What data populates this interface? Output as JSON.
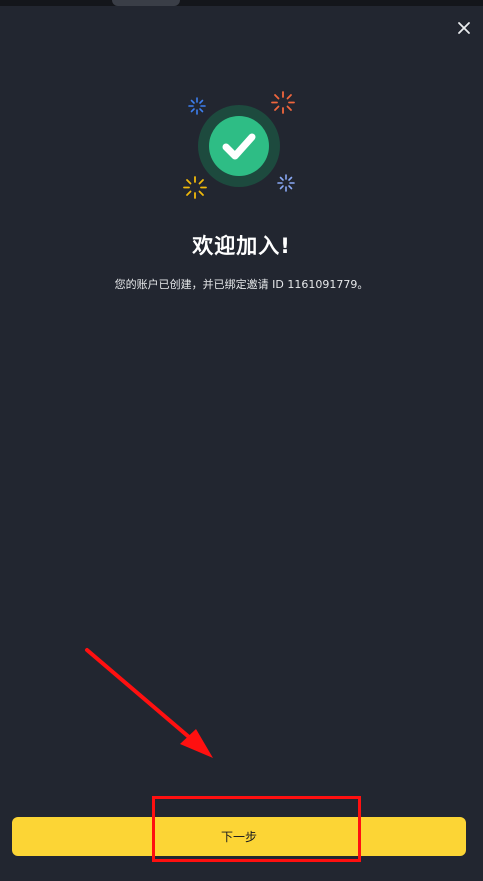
{
  "header": {
    "close_icon": "close-icon"
  },
  "hero": {
    "icon": "check-circle-icon",
    "accent_color": "#2ebd85",
    "sparkle_colors": [
      "#3d7ff0",
      "#f0663d",
      "#f0b90b",
      "#8aa9f5"
    ]
  },
  "main": {
    "title": "欢迎加入!",
    "subtitle": "您的账户已创建，并已绑定邀请 ID 1161091779。"
  },
  "footer": {
    "next_label": "下一步",
    "button_color": "#fcd535"
  },
  "annotations": {
    "arrow_color": "#ff1010",
    "highlight_color": "#ff1010"
  }
}
